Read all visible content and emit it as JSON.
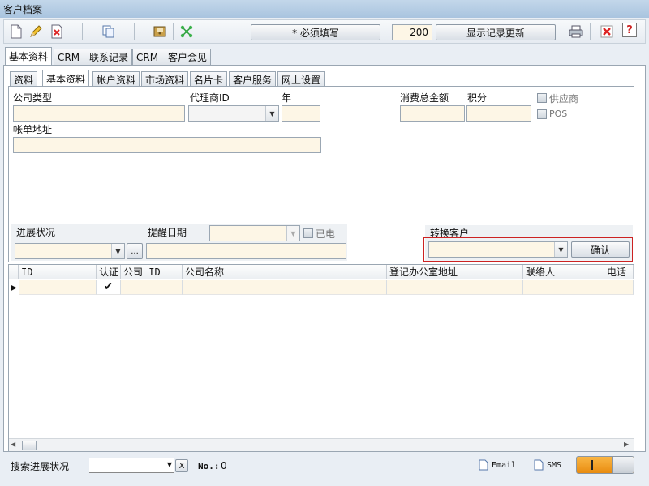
{
  "window": {
    "title": "客户档案"
  },
  "toolbar": {
    "required_label": "* 必须填写",
    "record_count": "200",
    "refresh_label": "显示记录更新",
    "help_label": "?"
  },
  "colors": {
    "field_bg": "#fdf6e6",
    "accent_red": "#cc2222",
    "toggle_orange": "#f4a020"
  },
  "main_tabs": [
    "基本资料",
    "CRM - 联系记录",
    "CRM - 客户会见"
  ],
  "sub_tabs": [
    "资料",
    "基本资料",
    "帐户资料",
    "市场资料",
    "名片卡",
    "客户服务",
    "网上设置"
  ],
  "form": {
    "company_type": "公司类型",
    "agent_id": "代理商ID",
    "year": "年",
    "total_spend": "消费总金额",
    "points": "积分",
    "supplier": "供应商",
    "pos": "POS",
    "billing_address": "帐单地址",
    "progress_status": "进展状况",
    "reminder_date": "提醒日期",
    "called": "已电",
    "convert_customer": "转换客户",
    "confirm": "确认",
    "browse": "..."
  },
  "grid": {
    "columns": [
      "ID",
      "认证",
      "公司 ID",
      "公司名称",
      "登记办公室地址",
      "联络人",
      "电话"
    ],
    "rows": [
      {
        "checked_mark": "✔"
      }
    ]
  },
  "status": {
    "search_progress": "搜索进展状况",
    "clear": "X",
    "no_label": "No.:",
    "no_value": "0",
    "email": "Email",
    "sms": "SMS"
  }
}
